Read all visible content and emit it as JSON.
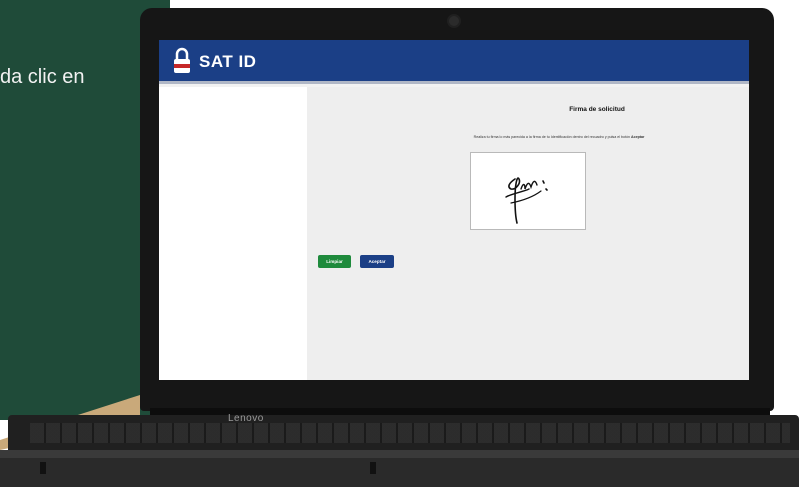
{
  "background": {
    "caption": "da clic en",
    "panel_color": "#1f4b39",
    "accent_color": "#c9a97a"
  },
  "laptop": {
    "brand": "Lenovo"
  },
  "app": {
    "title": "SAT ID",
    "header_color": "#1b3f86",
    "lock_icon": "lock-icon"
  },
  "form": {
    "title": "Firma de solicitud",
    "instructions": "Realiza tu firma lo más parecida a la firma de tu Identificación dentro del recuadro y pulsa el botón",
    "instructions_emphasis": "Aceptar",
    "signature_icon": "signature"
  },
  "buttons": {
    "clear_label": "Limpiar",
    "clear_color": "#1e8a3c",
    "accept_label": "Aceptar",
    "accept_color": "#1b3f86"
  }
}
